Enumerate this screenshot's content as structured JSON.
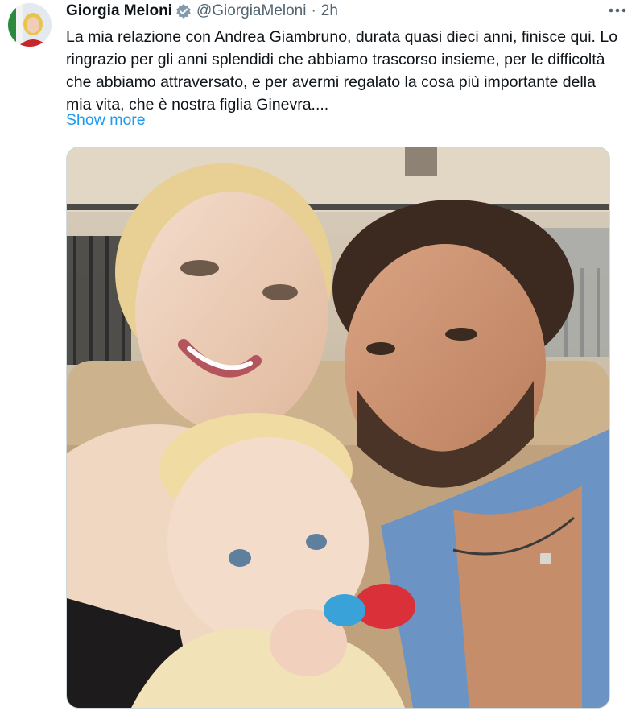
{
  "tweet": {
    "author_name": "Giorgia Meloni",
    "handle": "@GiorgiaMeloni",
    "separator": "·",
    "time": "2h",
    "more_icon": "more-horizontal-icon",
    "verified_icon": "verified-badge-icon",
    "text": "La mia relazione con Andrea Giambruno, durata quasi dieci anni, finisce qui. Lo ringrazio per gli anni splendidi che abbiamo trascorso insieme, per le difficoltà che abbiamo attraversato, e per avermi regalato la cosa più importante della mia vita, che è nostra figlia Ginevra....",
    "show_more_label": "Show more"
  },
  "colors": {
    "link": "#1d9bf0",
    "verified": "#829aab",
    "text": "#0f1419",
    "secondary": "#536471"
  }
}
